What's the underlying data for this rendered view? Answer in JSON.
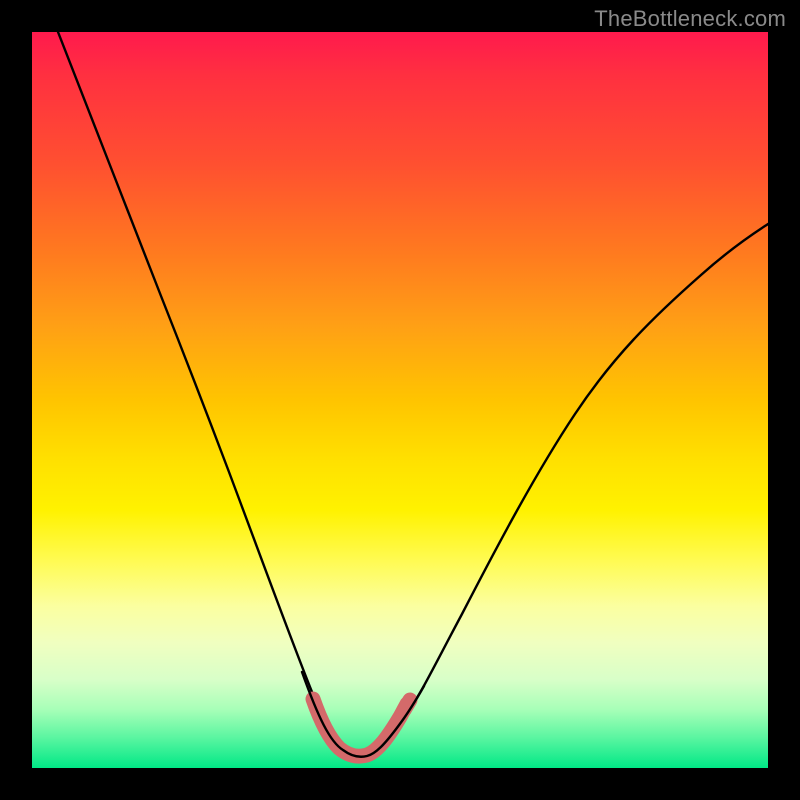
{
  "watermark": {
    "text": "TheBottleneck.com"
  },
  "chart_data": {
    "type": "line",
    "title": "",
    "xlabel": "",
    "ylabel": "",
    "xlim": [
      0,
      1
    ],
    "ylim": [
      0,
      1
    ],
    "grid": false,
    "legend": false,
    "series": [
      {
        "name": "bottleneck-curve",
        "color": "#000000",
        "x": [
          0.036,
          0.082,
          0.13,
          0.175,
          0.222,
          0.268,
          0.313,
          0.35,
          0.388,
          0.412,
          0.43,
          0.448,
          0.466,
          0.503,
          0.54,
          0.584,
          0.628,
          0.683,
          0.738,
          0.81,
          0.882,
          0.953,
          1.0
        ],
        "y": [
          1.0,
          0.88,
          0.76,
          0.643,
          0.525,
          0.406,
          0.282,
          0.176,
          0.079,
          0.041,
          0.021,
          0.012,
          0.021,
          0.063,
          0.127,
          0.21,
          0.3,
          0.403,
          0.494,
          0.59,
          0.66,
          0.703,
          0.72
        ]
      },
      {
        "name": "bottom-highlight",
        "color": "#d46a6a",
        "x": [
          0.382,
          0.4,
          0.418,
          0.436,
          0.455,
          0.473,
          0.491,
          0.509
        ],
        "y": [
          0.091,
          0.055,
          0.027,
          0.015,
          0.015,
          0.027,
          0.055,
          0.079
        ]
      }
    ],
    "colors": {
      "gradient_top": "#ff1a4d",
      "gradient_mid": "#fff200",
      "gradient_bottom": "#00e886",
      "curve": "#000000",
      "highlight": "#d46a6a",
      "frame": "#000000"
    }
  }
}
